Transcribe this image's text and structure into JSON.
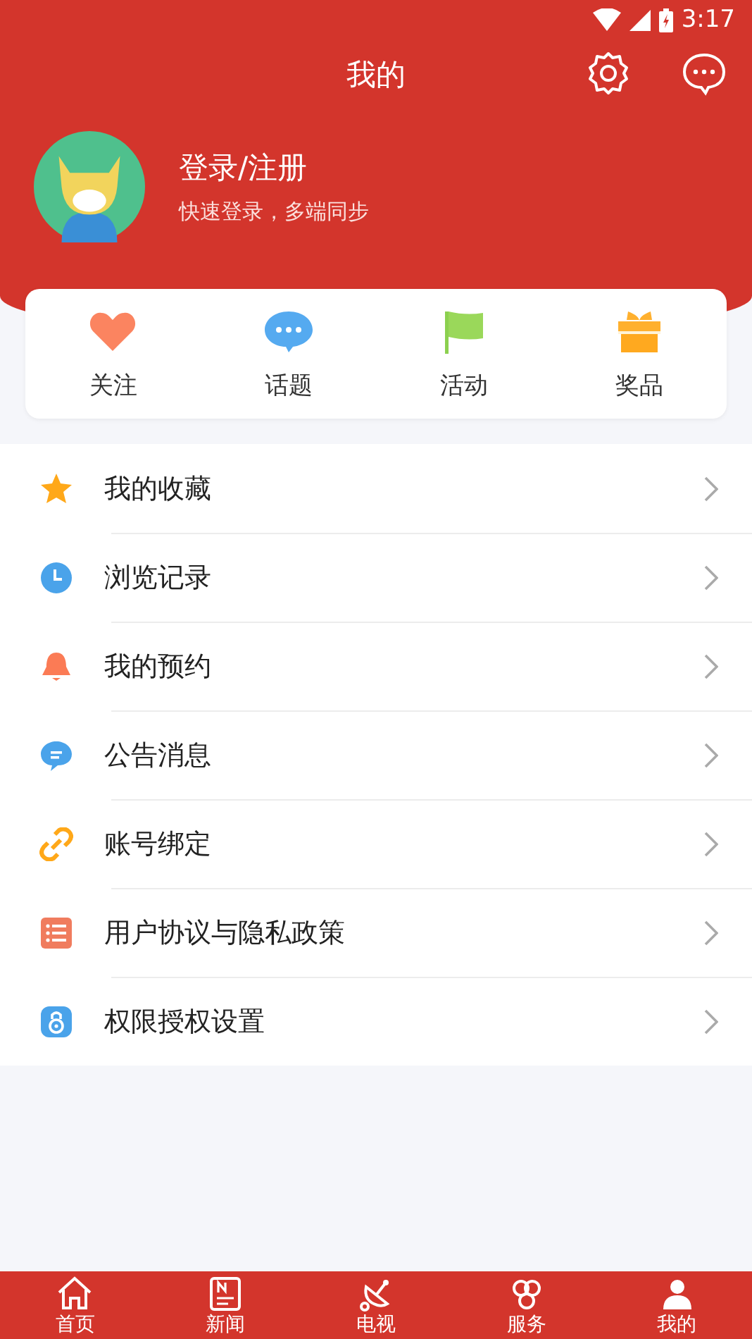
{
  "status_bar": {
    "time": "3:17"
  },
  "header": {
    "title": "我的"
  },
  "profile": {
    "name": "登录/注册",
    "subtitle": "快速登录，多端同步"
  },
  "shortcuts": [
    {
      "label": "关注"
    },
    {
      "label": "话题"
    },
    {
      "label": "活动"
    },
    {
      "label": "奖品"
    }
  ],
  "menu": [
    {
      "label": "我的收藏"
    },
    {
      "label": "浏览记录"
    },
    {
      "label": "我的预约"
    },
    {
      "label": "公告消息"
    },
    {
      "label": "账号绑定"
    },
    {
      "label": "用户协议与隐私政策"
    },
    {
      "label": "权限授权设置"
    }
  ],
  "tab_bar": [
    {
      "label": "首页"
    },
    {
      "label": "新闻"
    },
    {
      "label": "电视"
    },
    {
      "label": "服务"
    },
    {
      "label": "我的"
    }
  ]
}
